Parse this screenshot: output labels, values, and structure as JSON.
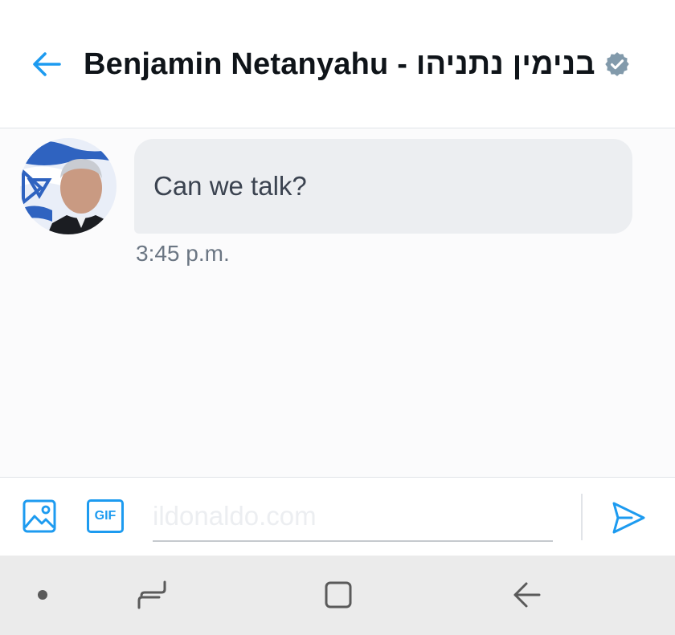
{
  "header": {
    "title": "Benjamin Netanyahu - בנימין נתניהו",
    "back_icon": "arrow-left-icon",
    "verified_icon": "verified-badge-icon"
  },
  "conversation": {
    "messages": [
      {
        "text": "Can we talk?",
        "time": "3:45 p.m."
      }
    ]
  },
  "composer": {
    "input_placeholder": "ildonaldo.com",
    "image_icon": "image-icon",
    "gif_label": "GIF",
    "send_icon": "send-icon"
  },
  "system_nav": {
    "items": [
      "dot-icon",
      "recents-icon",
      "home-icon",
      "back-icon"
    ]
  },
  "colors": {
    "accent": "#1d9bf0",
    "bubble": "#eceef1",
    "navbar": "#ebebeb",
    "verified": "#829aab"
  }
}
